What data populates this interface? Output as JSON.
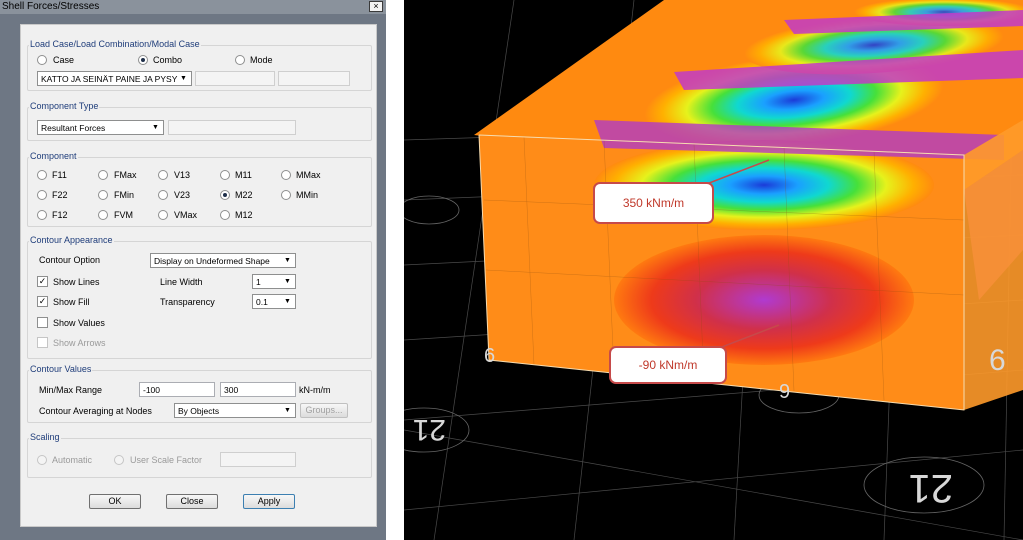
{
  "window": {
    "title": "Shell Forces/Stresses",
    "close_glyph": "×"
  },
  "load_case": {
    "title": "Load Case/Load Combination/Modal Case",
    "options": [
      {
        "label": "Case",
        "selected": false
      },
      {
        "label": "Combo",
        "selected": true
      },
      {
        "label": "Mode",
        "selected": false
      }
    ],
    "selected_combo": "KATTO JA SEINÄT PAINE JA PYSY"
  },
  "component_type": {
    "title": "Component Type",
    "selected": "Resultant Forces"
  },
  "component": {
    "title": "Component",
    "options": [
      {
        "label": "F11",
        "selected": false
      },
      {
        "label": "FMax",
        "selected": false
      },
      {
        "label": "V13",
        "selected": false
      },
      {
        "label": "M11",
        "selected": false
      },
      {
        "label": "MMax",
        "selected": false
      },
      {
        "label": "F22",
        "selected": false
      },
      {
        "label": "FMin",
        "selected": false
      },
      {
        "label": "V23",
        "selected": false
      },
      {
        "label": "M22",
        "selected": true
      },
      {
        "label": "MMin",
        "selected": false
      },
      {
        "label": "F12",
        "selected": false
      },
      {
        "label": "FVM",
        "selected": false
      },
      {
        "label": "VMax",
        "selected": false
      },
      {
        "label": "M12",
        "selected": false
      }
    ]
  },
  "contour_appearance": {
    "title": "Contour Appearance",
    "contour_option_label": "Contour Option",
    "contour_option_value": "Display on Undeformed Shape",
    "show_lines": {
      "label": "Show Lines",
      "checked": true
    },
    "show_fill": {
      "label": "Show Fill",
      "checked": true
    },
    "show_values": {
      "label": "Show Values",
      "checked": false
    },
    "show_arrows": {
      "label": "Show Arrows",
      "checked": false,
      "disabled": true
    },
    "line_width_label": "Line Width",
    "line_width_value": "1",
    "transparency_label": "Transparency",
    "transparency_value": "0.1",
    "check_glyph": "✓"
  },
  "contour_values": {
    "title": "Contour Values",
    "range_label": "Min/Max Range",
    "min": "-100",
    "max": "300",
    "units": "kN-m/m",
    "averaging_label": "Contour Averaging at Nodes",
    "averaging_value": "By Objects",
    "groups_button": "Groups..."
  },
  "scaling": {
    "title": "Scaling",
    "automatic_label": "Automatic",
    "user_scale_label": "User Scale Factor"
  },
  "buttons": {
    "ok": "OK",
    "close": "Close",
    "apply": "Apply"
  },
  "combo_arrow": "▼",
  "viewport": {
    "callouts": [
      {
        "text": "350 kNm/m"
      },
      {
        "text": "-90 kNm/m"
      }
    ],
    "grid_labels": [
      "6",
      "9",
      "21",
      "6",
      "21"
    ]
  }
}
